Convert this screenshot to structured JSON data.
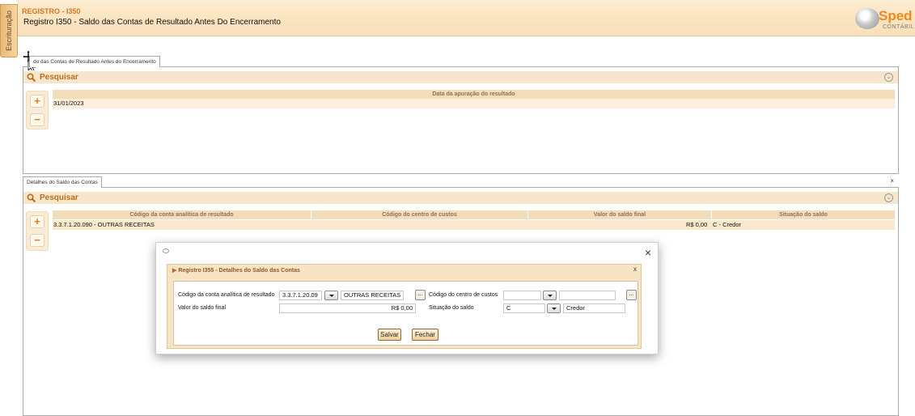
{
  "side_tab": {
    "label": "Escrituração"
  },
  "header": {
    "kicker": "REGISTRO - I350",
    "title": "Registro I350 - Saldo das Contas de Resultado Antes Do Encerramento",
    "logo_text": "Sped",
    "logo_sub": "CONTÁBIL"
  },
  "top_panel": {
    "tab_label": "do das Contas de Resultado Antes do Encerramento",
    "search_label": "Pesquisar",
    "column": "Data da apuração do resultado",
    "rows": [
      "31/01/2023"
    ]
  },
  "bottom_panel": {
    "tab_label": "Detalhes do Saldo das Contas",
    "close": "×",
    "search_label": "Pesquisar",
    "columns": [
      "Código da conta analítica de resultado",
      "Código do centro de custos",
      "Valor do saldo final",
      "Situação do saldo"
    ],
    "row": {
      "conta": "3.3.7.1.20.090 - OUTRAS RECEITAS",
      "valor": "R$ 0,00",
      "situacao": "C - Credor"
    }
  },
  "buttons": {
    "plus": "+",
    "minus": "−"
  },
  "modal": {
    "close": "×",
    "title": "Registro I355 - Detalhes do Saldo das Contas",
    "inner_close": "x",
    "fields": {
      "conta_label": "Código da conta analítica de resultado",
      "conta_value": "3.3.7.1.20.09",
      "conta_desc": "OUTRAS RECEITAS",
      "centro_label": "Código do centro de custos",
      "centro_value": "",
      "centro_desc": "",
      "valor_label": "Valor do saldo final",
      "valor_value": "R$ 0,00",
      "situacao_label": "Situação do saldo",
      "situacao_value": "C",
      "situacao_desc": "Credor",
      "ellipsis": "..."
    },
    "save_label": "Salvar",
    "close_label": "Fechar"
  },
  "colors": {
    "accent": "#e07b12",
    "band": "#f3ddb8",
    "header_bg": "#fbe4c0"
  }
}
